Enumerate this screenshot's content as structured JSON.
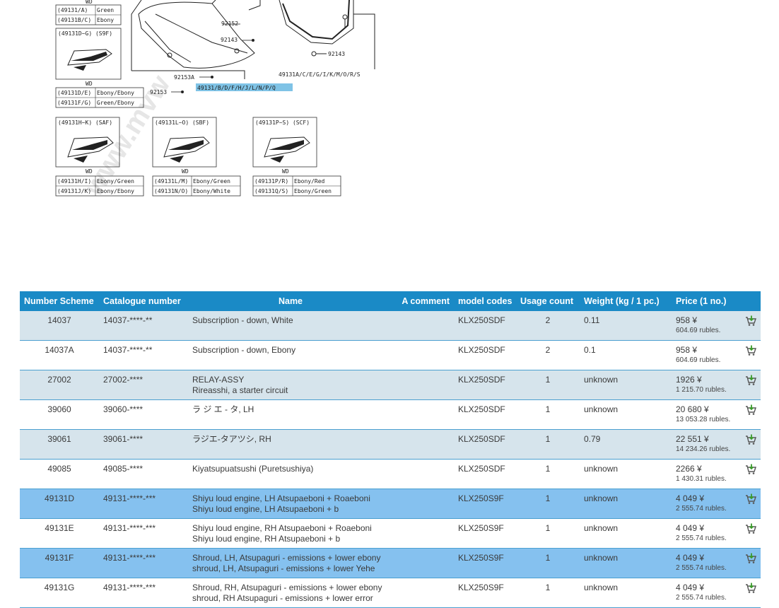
{
  "diagram": {
    "label_groups": [
      {
        "code": "(49131/A)",
        "color": "Green"
      },
      {
        "code": "(49131B/C)",
        "color": "Ebony"
      }
    ],
    "top_wd": "WD",
    "group1": {
      "title": "(49131D~G)  (S9F)",
      "wd": "WD",
      "rows": [
        {
          "code": "(49131D/E)",
          "color": "Ebony/Ebony"
        },
        {
          "code": "(49131F/G)",
          "color": "Green/Ebony"
        }
      ]
    },
    "group2": {
      "title": "(49131H~K)  (SAF)",
      "wd": "WD",
      "rows": [
        {
          "code": "(49131H/I)",
          "color": "Ebony/Green"
        },
        {
          "code": "(49131J/K)",
          "color": "Ebony/Ebony"
        }
      ]
    },
    "group3": {
      "title": "(49131L~O)  (SBF)",
      "wd": "WD",
      "rows": [
        {
          "code": "(49131L/M)",
          "color": "Ebony/Green"
        },
        {
          "code": "(49131N/O)",
          "color": "Ebony/White"
        }
      ]
    },
    "group4": {
      "title": "(49131P~S)  (SCF)",
      "wd": "WD",
      "rows": [
        {
          "code": "(49131P/R)",
          "color": "Ebony/Red"
        },
        {
          "code": "(49131Q/S)",
          "color": "Ebony/Green"
        }
      ]
    },
    "callouts": {
      "c92152": "92152",
      "c92143a": "92143",
      "c92143b": "92143",
      "c92153a": "92153A",
      "c92153": "92153",
      "c_right": "49131A/C/E/G/I/K/M/O/R/S",
      "c_highlight": "49131/B/D/F/H/J/L/N/P/Q"
    },
    "watermark": "www.mvw"
  },
  "table": {
    "headers": {
      "number_scheme": "Number Scheme",
      "catalogue_number": "Catalogue number",
      "name": "Name",
      "comment": "A comment",
      "model_codes": "model codes",
      "usage_count": "Usage count",
      "weight": "Weight (kg / 1 pc.)",
      "price": "Price (1 no.)"
    },
    "rows": [
      {
        "scheme": "14037",
        "catalogue": "14037-****-**",
        "name1": "Subscription - down, White",
        "name2": "",
        "comment": "",
        "model": "KLX250SDF",
        "usage": "2",
        "weight": "0.11",
        "price": "958 ¥",
        "rubles": "604.69 rubles.",
        "style": "odd"
      },
      {
        "scheme": "14037A",
        "catalogue": "14037-****-**",
        "name1": "Subscription - down, Ebony",
        "name2": "",
        "comment": "",
        "model": "KLX250SDF",
        "usage": "2",
        "weight": "0.1",
        "price": "958 ¥",
        "rubles": "604.69 rubles.",
        "style": "even"
      },
      {
        "scheme": "27002",
        "catalogue": "27002-****",
        "name1": "RELAY-ASSY",
        "name2": "Rireasshi, a starter circuit",
        "comment": "",
        "model": "KLX250SDF",
        "usage": "1",
        "weight": "unknown",
        "price": "1926 ¥",
        "rubles": "1 215.70 rubles.",
        "style": "odd"
      },
      {
        "scheme": "39060",
        "catalogue": "39060-****",
        "name1": "ラ ジ エ - タ, LH",
        "name2": "",
        "comment": "",
        "model": "KLX250SDF",
        "usage": "1",
        "weight": "unknown",
        "price": "20 680 ¥",
        "rubles": "13 053.28 rubles.",
        "style": "even"
      },
      {
        "scheme": "39061",
        "catalogue": "39061-****",
        "name1": "ラジエ-タアツシ,  RH",
        "name2": "",
        "comment": "",
        "model": "KLX250SDF",
        "usage": "1",
        "weight": "0.79",
        "price": "22 551 ¥",
        "rubles": "14 234.26 rubles.",
        "style": "odd"
      },
      {
        "scheme": "49085",
        "catalogue": "49085-****",
        "name1": "Kiyatsupuatsushi (Puretsushiya)",
        "name2": "",
        "comment": "",
        "model": "KLX250SDF",
        "usage": "1",
        "weight": "unknown",
        "price": "2266 ¥",
        "rubles": "1 430.31 rubles.",
        "style": "even"
      },
      {
        "scheme": "49131D",
        "catalogue": "49131-****-***",
        "name1": "Shiyu loud engine, LH Atsupaeboni + Roaeboni",
        "name2": "Shiyu loud engine, LH Atsupaeboni + b",
        "comment": "",
        "model": "KLX250S9F",
        "usage": "1",
        "weight": "unknown",
        "price": "4 049 ¥",
        "rubles": "2 555.74 rubles.",
        "style": "hl"
      },
      {
        "scheme": "49131E",
        "catalogue": "49131-****-***",
        "name1": "Shiyu loud engine, RH Atsupaeboni + Roaeboni",
        "name2": "Shiyu loud engine, RH Atsupaeboni + b",
        "comment": "",
        "model": "KLX250S9F",
        "usage": "1",
        "weight": "unknown",
        "price": "4 049 ¥",
        "rubles": "2 555.74 rubles.",
        "style": "even"
      },
      {
        "scheme": "49131F",
        "catalogue": "49131-****-***",
        "name1": "Shroud, LH, Atsupaguri - emissions + lower ebony",
        "name2": "shroud, LH, Atsupaguri - emissions + lower Yehe",
        "comment": "",
        "model": "KLX250S9F",
        "usage": "1",
        "weight": "unknown",
        "price": "4 049 ¥",
        "rubles": "2 555.74 rubles.",
        "style": "hl"
      },
      {
        "scheme": "49131G",
        "catalogue": "49131-****-***",
        "name1": "Shroud, RH, Atsupaguri - emissions + lower ebony",
        "name2": "shroud, RH Atsupaguri - emissions + lower error",
        "comment": "",
        "model": "KLX250S9F",
        "usage": "1",
        "weight": "unknown",
        "price": "4 049 ¥",
        "rubles": "2 555.74 rubles.",
        "style": "even"
      }
    ],
    "cart_icon": "add-to-cart-icon"
  },
  "colors": {
    "header_bg": "#1a8ac6",
    "row_odd": "#d6e4ec",
    "row_highlight": "#85c1ef",
    "callout_highlight": "#7fc3e6"
  }
}
